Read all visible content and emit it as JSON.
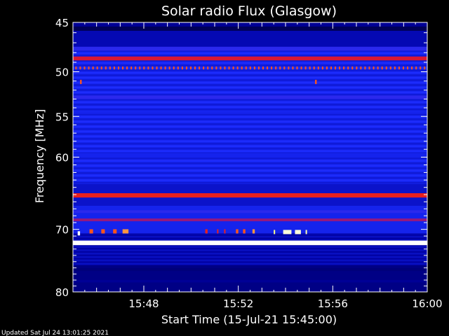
{
  "chart_data": {
    "type": "heatmap",
    "title": "Solar radio Flux (Glasgow)",
    "xlabel": "Start Time (15-Jul-21 15:45:00)",
    "ylabel": "Frequency [MHz]",
    "x_tick_labels": [
      "15:48",
      "15:52",
      "15:56",
      "16:00"
    ],
    "x_ticks_minutes": [
      3,
      7,
      11,
      15
    ],
    "xlim_minutes": [
      0,
      15
    ],
    "ylim": [
      45,
      80
    ],
    "y_ticks": [
      45,
      50,
      55,
      60,
      70,
      80
    ],
    "y_inverted": true,
    "y_scale": "log",
    "grid": false,
    "colormap": [
      "#000040",
      "#0000a0",
      "#1a2cff",
      "#c8104a",
      "#ff2a00",
      "#ffff80",
      "#ffffff"
    ],
    "horizontal_bands": [
      {
        "freq_start": 45.0,
        "freq_end": 45.4,
        "level": 0.15
      },
      {
        "freq_start": 47.4,
        "freq_end": 47.8,
        "level": 0.35
      },
      {
        "freq_start": 48.4,
        "freq_end": 48.8,
        "level": 0.55
      },
      {
        "freq_start": 52.6,
        "freq_end": 53.0,
        "level": 0.35
      },
      {
        "freq_start": 54.4,
        "freq_end": 54.7,
        "level": 0.3
      },
      {
        "freq_start": 59.5,
        "freq_end": 60.0,
        "level": 0.3
      },
      {
        "freq_start": 64.8,
        "freq_end": 65.4,
        "level": 0.6
      },
      {
        "freq_start": 67.2,
        "freq_end": 67.6,
        "level": 0.35
      },
      {
        "freq_start": 68.4,
        "freq_end": 68.8,
        "level": 0.45
      },
      {
        "freq_start": 71.7,
        "freq_end": 72.4,
        "level": 1.0
      },
      {
        "freq_start": 76.0,
        "freq_end": 76.5,
        "level": 0.1
      },
      {
        "freq_start": 78.0,
        "freq_end": 78.4,
        "level": 0.15
      }
    ],
    "dotted_lines": [
      {
        "freq": 49.6,
        "spacing_minutes": 0.18,
        "level": 0.7
      }
    ],
    "bursts": [
      {
        "time_minutes": 0.2,
        "freq": 70.6,
        "duration_minutes": 0.1,
        "level": 1.0
      },
      {
        "time_minutes": 0.7,
        "freq": 70.3,
        "duration_minutes": 0.15,
        "level": 0.7
      },
      {
        "time_minutes": 1.2,
        "freq": 70.3,
        "duration_minutes": 0.15,
        "level": 0.7
      },
      {
        "time_minutes": 1.7,
        "freq": 70.3,
        "duration_minutes": 0.15,
        "level": 0.7
      },
      {
        "time_minutes": 2.1,
        "freq": 70.3,
        "duration_minutes": 0.25,
        "level": 0.75
      },
      {
        "time_minutes": 5.6,
        "freq": 70.3,
        "duration_minutes": 0.1,
        "level": 0.6
      },
      {
        "time_minutes": 6.1,
        "freq": 70.3,
        "duration_minutes": 0.05,
        "level": 0.6
      },
      {
        "time_minutes": 6.4,
        "freq": 70.3,
        "duration_minutes": 0.05,
        "level": 0.6
      },
      {
        "time_minutes": 6.9,
        "freq": 70.3,
        "duration_minutes": 0.1,
        "level": 0.7
      },
      {
        "time_minutes": 7.2,
        "freq": 70.3,
        "duration_minutes": 0.1,
        "level": 0.7
      },
      {
        "time_minutes": 7.6,
        "freq": 70.3,
        "duration_minutes": 0.1,
        "level": 0.75
      },
      {
        "time_minutes": 8.5,
        "freq": 70.4,
        "duration_minutes": 0.05,
        "level": 0.85
      },
      {
        "time_minutes": 8.9,
        "freq": 70.4,
        "duration_minutes": 0.35,
        "level": 0.95
      },
      {
        "time_minutes": 9.4,
        "freq": 70.4,
        "duration_minutes": 0.25,
        "level": 0.95
      },
      {
        "time_minutes": 9.85,
        "freq": 70.4,
        "duration_minutes": 0.05,
        "level": 0.9
      },
      {
        "time_minutes": 0.3,
        "freq": 51.1,
        "duration_minutes": 0.07,
        "level": 0.7
      },
      {
        "time_minutes": 10.25,
        "freq": 51.1,
        "duration_minutes": 0.07,
        "level": 0.7
      }
    ]
  },
  "footer": {
    "updated": "Updated Sat Jul 24 13:01:25 2021"
  }
}
